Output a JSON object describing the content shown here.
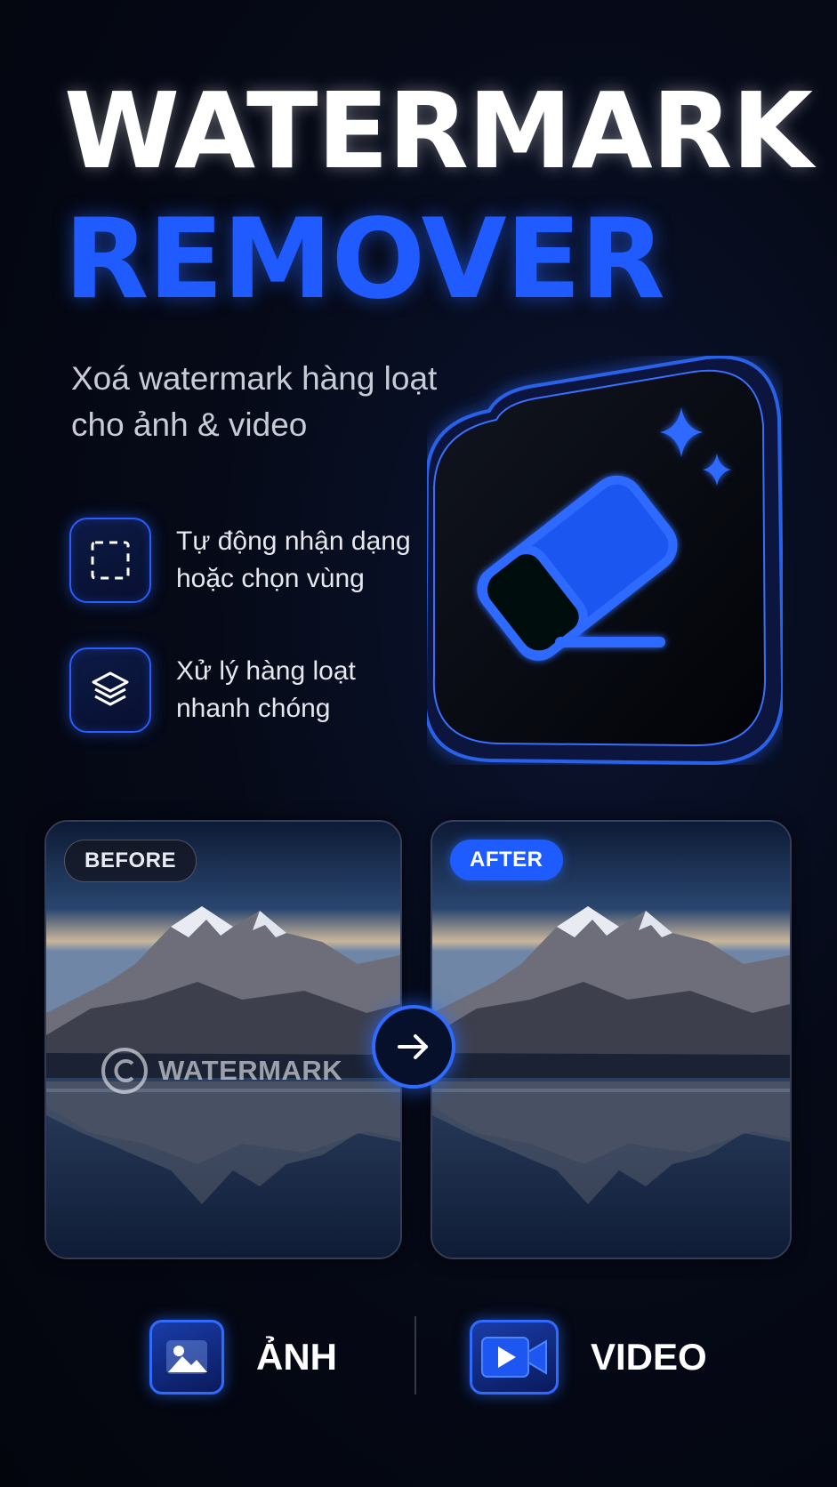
{
  "title": {
    "line1": "WATERMARK",
    "line2": "REMOVER"
  },
  "subtitle": {
    "line1": "Xoá watermark hàng loạt",
    "line2": "cho ảnh & video"
  },
  "features": [
    {
      "icon": "dashed-selection-icon",
      "line1": "Tự động nhận dạng",
      "line2": "hoặc chọn vùng"
    },
    {
      "icon": "layers-icon",
      "line1": "Xử lý hàng loạt",
      "line2": "nhanh chóng"
    }
  ],
  "app_icon": {
    "icon": "eraser-icon",
    "accent": "sparkles-icon"
  },
  "comparison": {
    "before_label": "BEFORE",
    "after_label": "AFTER",
    "watermark_symbol": "©",
    "watermark_text": "WATERMARK",
    "arrow_icon": "arrow-right-icon"
  },
  "media": [
    {
      "icon": "image-icon",
      "label": "ẢNH"
    },
    {
      "icon": "video-camera-icon",
      "label": "VIDEO"
    }
  ],
  "colors": {
    "accent": "#1f5bff",
    "background": "#03050d",
    "text": "#ffffff"
  }
}
